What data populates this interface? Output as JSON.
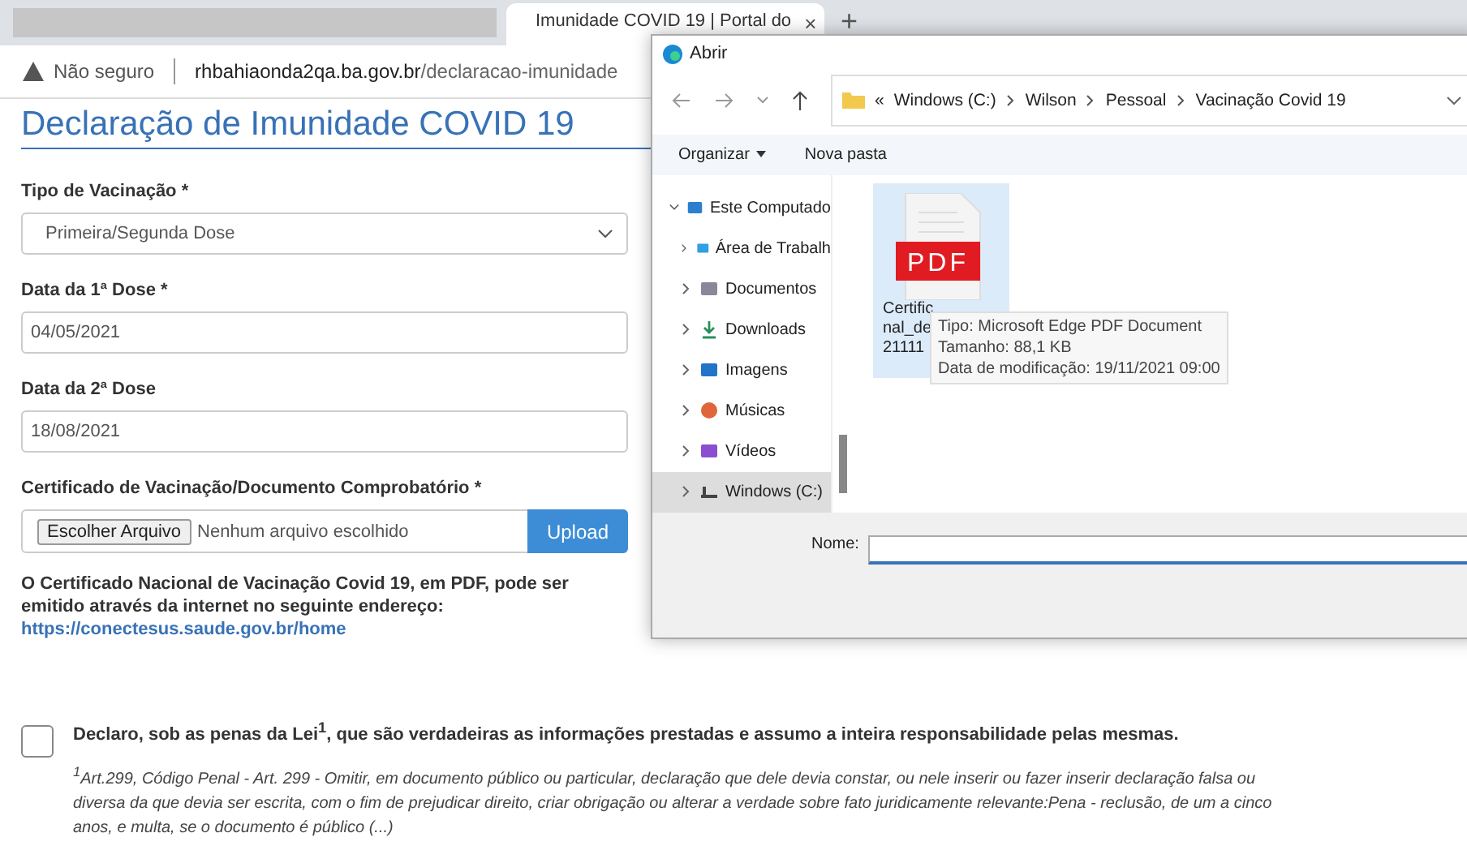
{
  "browser": {
    "tab": {
      "title": "Imunidade COVID 19 | Portal do",
      "close": "×",
      "selected": true
    },
    "new_tab": "+",
    "address": {
      "security": "Não seguro",
      "host": "rhbahiaonda2qa.ba.gov.br",
      "path": "/declaracao-imunidade"
    }
  },
  "page": {
    "title": "Declaração de Imunidade COVID 19",
    "fields": [
      {
        "kind": "select",
        "label": "Tipo de Vacinação *",
        "value": "Primeira/Segunda Dose"
      },
      {
        "kind": "text",
        "label": "Data da 1ª Dose *",
        "value": "04/05/2021"
      },
      {
        "kind": "text",
        "label": "Data da 2ª Dose",
        "value": "18/08/2021"
      },
      {
        "kind": "file",
        "label": "Certificado de Vacinação/Documento Comprobatório *",
        "button": "Escolher Arquivo",
        "status": "Nenhum arquivo escolhido",
        "action": "Upload"
      }
    ],
    "info": {
      "text": "O Certificado Nacional de Vacinação Covid 19, em PDF, pode ser emitido através da internet no seguinte endereço:",
      "link": "https://conectesus.saude.gov.br/home"
    },
    "declaration": {
      "checked": false,
      "text": "Declaro, sob as penas da Lei$^{1}$, que são verdadeiras as informações prestadas e assumo a inteira responsabilidade pelas mesmas.",
      "footnote": "$^{1}$Art.299, Código Penal - Art. 299 - Omitir, em documento público ou particular, declaração que dele devia constar, ou nele inserir ou fazer inserir declaração falsa ou diversa da que devia ser escrita, com o fim de prejudicar direito, criar obrigação ou alterar a verdade sobre fato juridicamente relevante:Pena - reclusão, de um a cinco anos, e multa, se o documento é público (...)"
    }
  },
  "dialog": {
    "title": "Abrir",
    "overflow": "«",
    "path": [
      "Windows (C:)",
      "Wilson",
      "Pessoal",
      "Vacinação Covid 19"
    ],
    "toolbar": [
      {
        "label": "Organizar",
        "menu": true
      },
      {
        "label": "Nova pasta",
        "menu": false
      }
    ],
    "tree": [
      {
        "kind": "computer",
        "label": "Este Computado",
        "expanded": true,
        "selected": false,
        "children": [
          {
            "kind": "desktop",
            "label": "Área de Trabalh",
            "selected": false
          },
          {
            "kind": "documents",
            "label": "Documentos",
            "selected": false
          },
          {
            "kind": "downloads",
            "label": "Downloads",
            "selected": false
          },
          {
            "kind": "pictures",
            "label": "Imagens",
            "selected": false
          },
          {
            "kind": "music",
            "label": "Músicas",
            "selected": false
          },
          {
            "kind": "videos",
            "label": "Vídeos",
            "selected": false
          },
          {
            "kind": "drive",
            "label": "Windows (C:)",
            "selected": true
          }
        ]
      }
    ],
    "files": [
      {
        "kind": "pdf",
        "badge": "PDF",
        "name_lines": [
          "Certific",
          "nal_de",
          "21111"
        ],
        "selected": true
      }
    ],
    "tooltip": [
      "Tipo: Microsoft Edge PDF Document",
      "Tamanho: 88,1 KB",
      "Data de modificação: 19/11/2021 09:00"
    ],
    "name_label": "Nome:"
  }
}
